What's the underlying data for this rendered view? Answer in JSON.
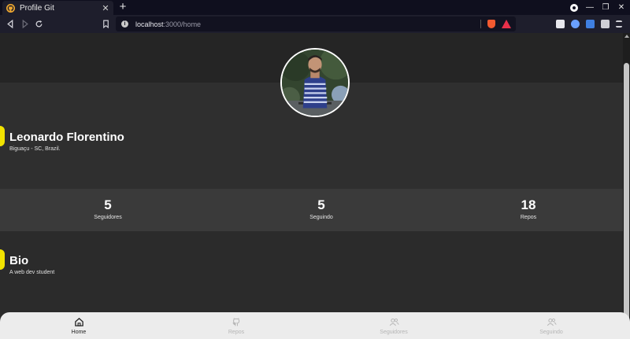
{
  "browser": {
    "tab_title": "Profile Git",
    "tab_close": "✕",
    "new_tab": "+",
    "url_host": "localhost",
    "url_path": ":3000/home"
  },
  "profile": {
    "name": "Leonardo Florentino",
    "location": "Biguaçu - SC, Brazil."
  },
  "stats": [
    {
      "value": "5",
      "label": "Seguidores"
    },
    {
      "value": "5",
      "label": "Seguindo"
    },
    {
      "value": "18",
      "label": "Repos"
    }
  ],
  "bio": {
    "title": "Bio",
    "text": "A web dev student"
  },
  "bottom_nav": [
    {
      "label": "Home",
      "icon": "home-icon",
      "active": true
    },
    {
      "label": "Repos",
      "icon": "github-icon",
      "active": false
    },
    {
      "label": "Seguidores",
      "icon": "users-icon",
      "active": false
    },
    {
      "label": "Seguindo",
      "icon": "users-icon",
      "active": false
    }
  ],
  "colors": {
    "accent": "#f2e300",
    "page_bg": "#2b2b2b",
    "stats_bg": "#3a3a3a",
    "nav_bg": "#ececec"
  }
}
